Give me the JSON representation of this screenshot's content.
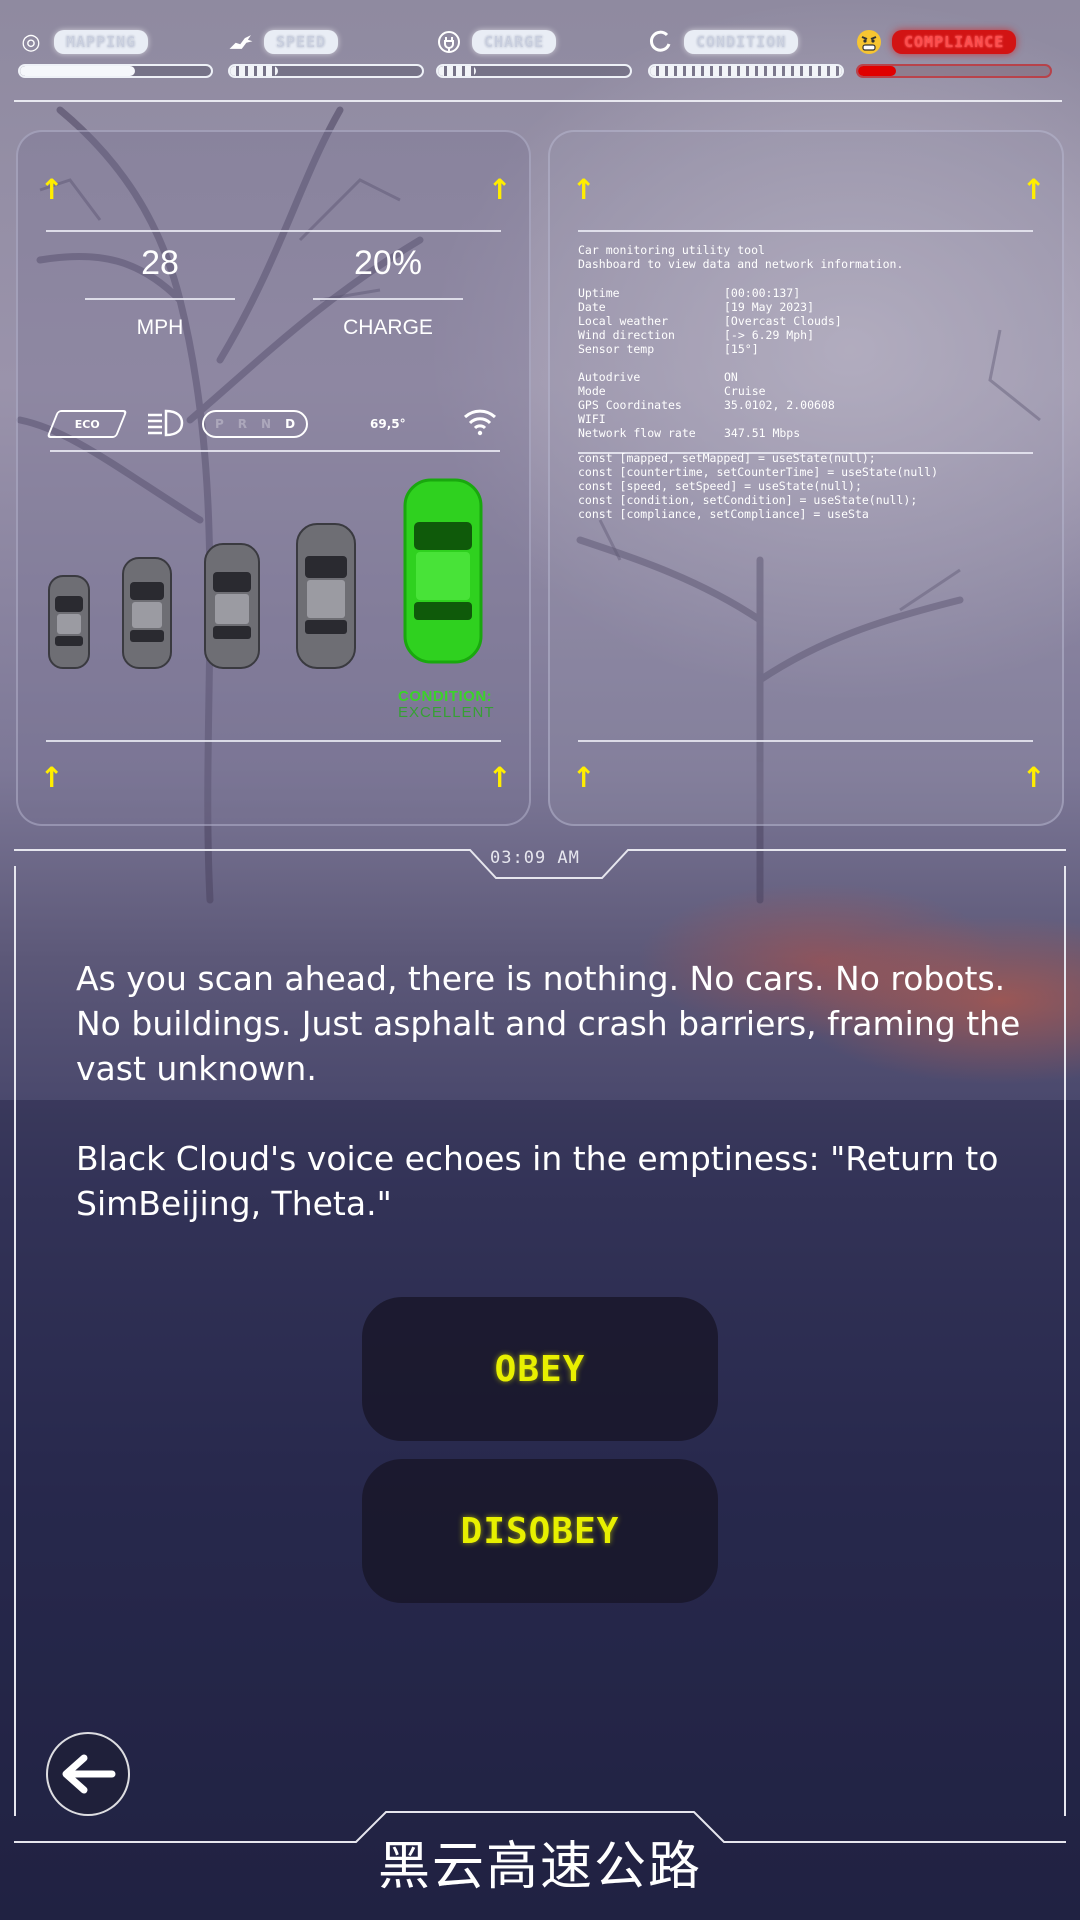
{
  "status_bar": {
    "mapping": {
      "label": "MAPPING",
      "level": 0.6
    },
    "speed": {
      "label": "SPEED",
      "level": 0.25
    },
    "charge": {
      "label": "CHARGE",
      "level": 0.2
    },
    "condition": {
      "label": "CONDITION",
      "level": 1.0
    },
    "compliance": {
      "label": "COMPLIANCE",
      "level": 0.2,
      "color": "#d21414"
    }
  },
  "dashboard": {
    "speed_value": "28",
    "speed_unit": "MPH",
    "charge_value": "20%",
    "charge_label": "CHARGE",
    "mode_badge": "ECO",
    "gears": [
      "P",
      "R",
      "N",
      "D"
    ],
    "active_gear": "D",
    "temperature": "69,5°",
    "condition_label": "CONDITION:",
    "condition_value": "EXCELLENT",
    "condition_color": "#3bd22a"
  },
  "console": {
    "title": "Car monitoring utility tool",
    "subtitle": "Dashboard to view data and network information.",
    "rows1": [
      {
        "k": "Uptime",
        "v": "[00:00:137]"
      },
      {
        "k": "Date",
        "v": "[19 May 2023]"
      },
      {
        "k": "Local weather",
        "v": "[Overcast Clouds]"
      },
      {
        "k": "Wind direction",
        "v": "[-> 6.29 Mph]"
      },
      {
        "k": "Sensor temp",
        "v": "[15°]"
      }
    ],
    "rows2": [
      {
        "k": "Autodrive",
        "v": "ON"
      },
      {
        "k": "Mode",
        "v": "Cruise"
      },
      {
        "k": "GPS Coordinates",
        "v": "35.0102, 2.00608"
      },
      {
        "k": "WIFI",
        "v": ""
      },
      {
        "k": "Network flow rate",
        "v": "347.51 Mbps"
      }
    ],
    "code": [
      "const [mapped, setMapped] = useState(null);",
      "const [countertime, setCounterTime] = useState(null)",
      "const [speed, setSpeed] = useState(null);",
      "const [condition, setCondition] = useState(null);",
      "const [compliance, setCompliance] = useSta"
    ]
  },
  "clock": "03:09 AM",
  "story": {
    "paragraph1": "As you scan ahead, there is nothing. No cars. No robots. No buildings. Just asphalt and crash barriers, framing the vast unknown.",
    "paragraph2": "Black Cloud's voice echoes in the emptiness: \"Return to SimBeijing, Theta.\""
  },
  "choices": {
    "obey": "OBEY",
    "disobey": "DISOBEY"
  },
  "footer_title": "黑云高速公路",
  "colors": {
    "accent_yellow": "#e8f000",
    "arrow_yellow": "#ffee00",
    "green": "#3bd22a",
    "red": "#e00000"
  },
  "icons": [
    "mapping-icon",
    "horse-icon",
    "plug-icon",
    "condition-icon",
    "angry-emoji-icon",
    "headlight-icon",
    "wifi-icon",
    "back-arrow-icon"
  ]
}
